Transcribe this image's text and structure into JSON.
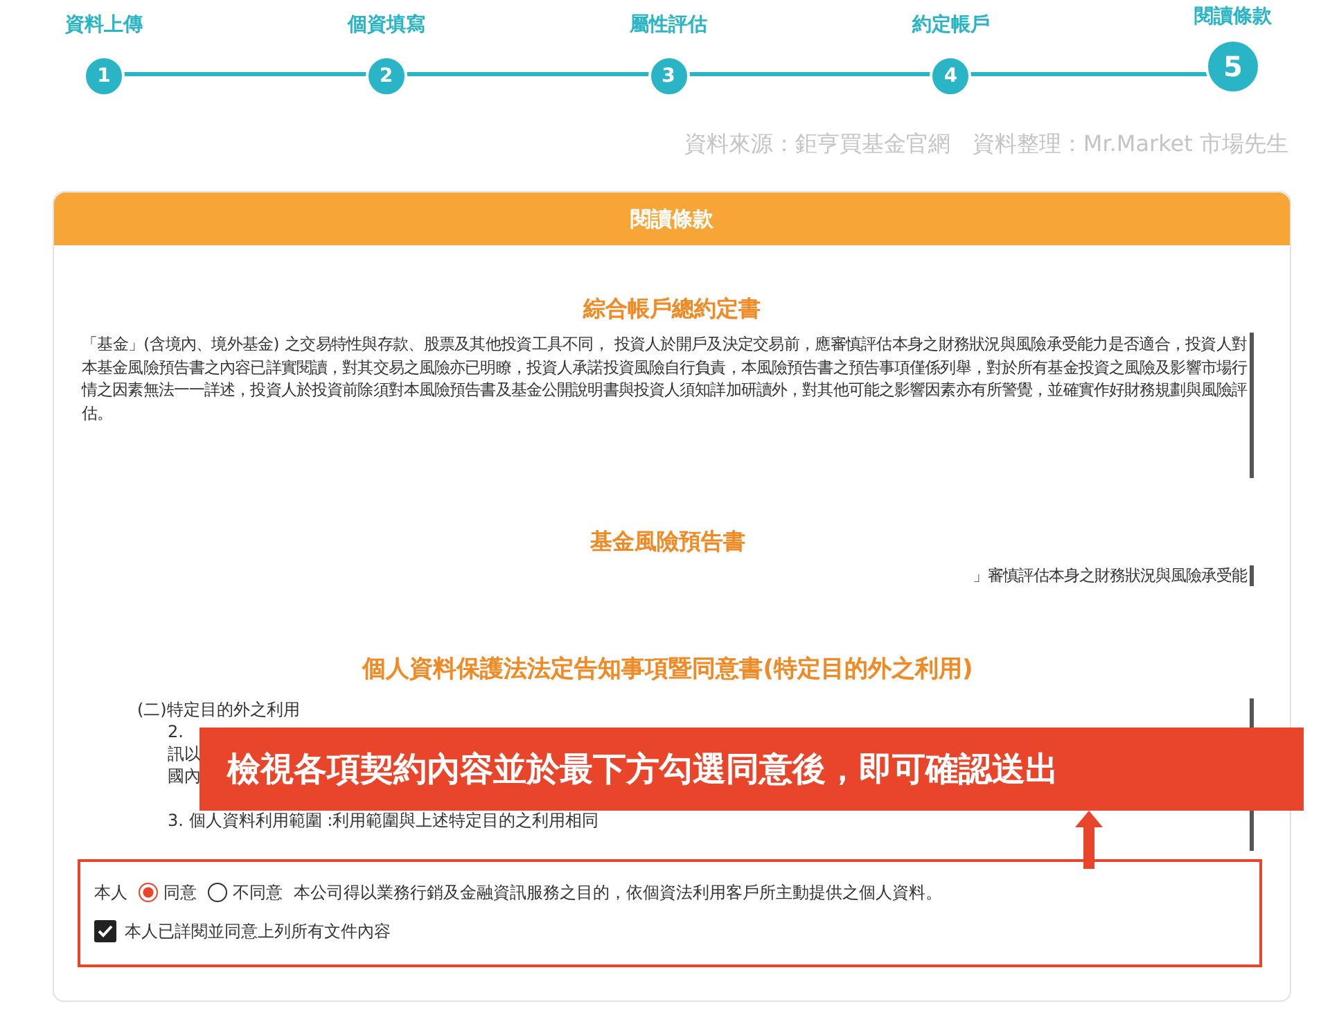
{
  "steps": [
    {
      "number": "1",
      "label": "資料上傳",
      "selected": false
    },
    {
      "number": "2",
      "label": "個資填寫",
      "selected": false
    },
    {
      "number": "3",
      "label": "屬性評估",
      "selected": false
    },
    {
      "number": "4",
      "label": "約定帳戶",
      "selected": false
    },
    {
      "number": "5",
      "label": "閱讀條款",
      "selected": true
    }
  ],
  "source_note": "資料來源：鉅亨買基金官網　資料整理：Mr.Market 市場先生",
  "card": {
    "title": "閱讀條款",
    "sections": [
      {
        "title": "綜合帳戶總約定書",
        "lines": [
          "「基金」(含境內、境外基金) 之交易特性與存款、股票及其他投資工具不同， 投資人於開戶及決定交易前，應審慎評估本身之財務狀況與風險承受能力是否適合，投資人對本基金風險預告書之內容已詳實閱讀，對其交易之風險亦已明瞭，投資人承諾投資風險自行負責，本風險預告書之預告事項僅係列舉，對於所有基金投資之風險及影響市場行情之因素無法一一詳述，投資人於投資前除須對本風險預告書及基金公開說明書與投資人須知詳加研讀外，對其他可能之影響因素亦有所警覺，並確實作好財務規劃與風險評估。"
        ]
      },
      {
        "title": "基金風險預告書",
        "lines": [
          "」審慎評估本身之財務狀況與風險承受能"
        ]
      },
      {
        "title": "個人資料保護法法定告知事項暨同意書(特定目的外之利用)",
        "lines": [
          "(二)特定目的外之利用",
          "2.",
          "訊以",
          "國內",
          "3. 個人資料利用範圍 :利用範圍與上述特定目的之利用相同"
        ]
      }
    ],
    "consent": {
      "prefix": "本人",
      "options": [
        {
          "label": "同意",
          "selected": true
        },
        {
          "label": "不同意",
          "selected": false
        }
      ],
      "statement": "本公司得以業務行銷及金融資訊服務之目的，依個資法利用客戶所主動提供之個人資料。",
      "checkbox": {
        "label": "本人已詳閱並同意上列所有文件內容",
        "checked": true
      }
    }
  },
  "callout": "檢視各項契約內容並於最下方勾選同意後，即可確認送出"
}
